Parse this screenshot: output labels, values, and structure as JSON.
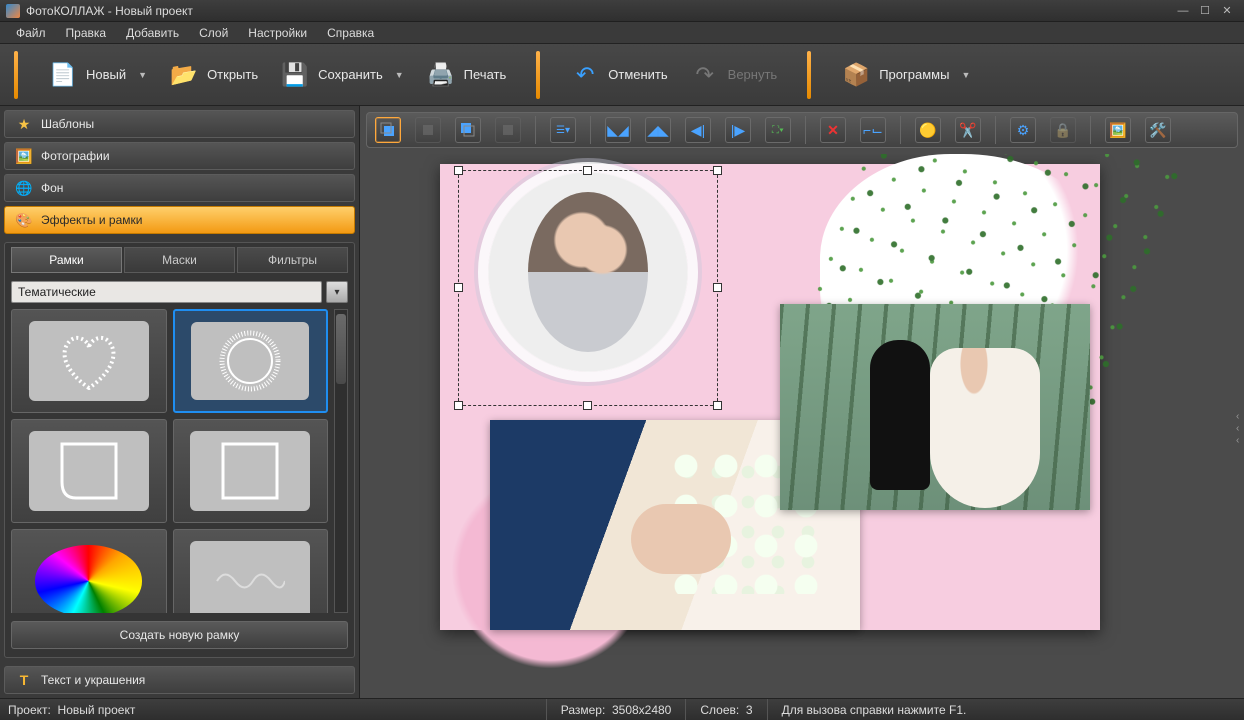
{
  "title": "ФотоКОЛЛАЖ - Новый проект",
  "menu": {
    "file": "Файл",
    "edit": "Правка",
    "add": "Добавить",
    "layer": "Слой",
    "settings": "Настройки",
    "help": "Справка"
  },
  "toolbar": {
    "new": "Новый",
    "open": "Открыть",
    "save": "Сохранить",
    "print": "Печать",
    "undo": "Отменить",
    "redo": "Вернуть",
    "programs": "Программы"
  },
  "sidebar": {
    "templates": "Шаблоны",
    "photos": "Фотографии",
    "background": "Фон",
    "effects": "Эффекты и рамки",
    "text": "Текст и украшения",
    "tabs": {
      "frames": "Рамки",
      "masks": "Маски",
      "filters": "Фильтры"
    },
    "category": "Тематические",
    "create_new": "Создать новую рамку"
  },
  "propsbar": {
    "tools": [
      "layer-front",
      "layer-forward",
      "layer-back",
      "layer-backward",
      "align",
      "flip-h",
      "flip-v",
      "mirror-h",
      "mirror-v",
      "fit",
      "delete",
      "crop",
      "edit",
      "cut",
      "settings",
      "lock",
      "add-image",
      "image-settings"
    ]
  },
  "status": {
    "project_label": "Проект:",
    "project_name": "Новый проект",
    "size_label": "Размер:",
    "size_value": "3508x2480",
    "layers_label": "Слоев:",
    "layers_value": "3",
    "hint": "Для вызова справки нажмите F1."
  },
  "colors": {
    "accent": "#f39a13",
    "accent2": "#1f8ef1"
  }
}
